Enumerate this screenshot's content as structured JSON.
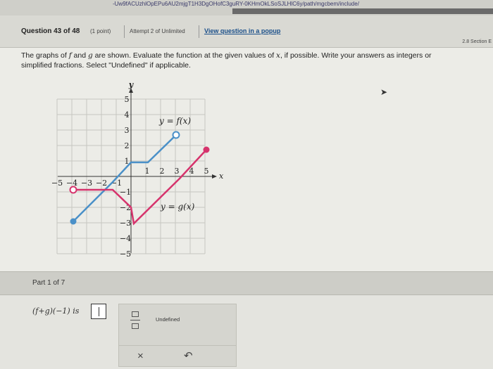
{
  "browser": {
    "url_fragment": "-Uw9fACUzhlOpEPu6AU2mjgT1H3DgOHofC3guRY-0KHmOkLSoSJLHlC6y/path/mgcbem/include/"
  },
  "header": {
    "question_number": "Question 43 of 48",
    "points": "(1 point)",
    "attempt": "Attempt 2 of Unlimited",
    "view_popup": "View question in a popup",
    "section": "2.8 Section E"
  },
  "question": {
    "text_a": "The graphs of ",
    "f": "f",
    "text_b": " and ",
    "g": "g",
    "text_c": " are shown. Evaluate the function at the given values of ",
    "x": "x",
    "text_d": ", if possible. Write your answers as integers or",
    "line2": "simplified fractions. Select \"Undefined\" if applicable."
  },
  "graph": {
    "x_axis_label": "x",
    "y_axis_label": "y",
    "x_ticks_neg": [
      "−5",
      "−4",
      "−3",
      "−2",
      "−1"
    ],
    "x_ticks_pos": [
      "1",
      "2",
      "3",
      "4",
      "5"
    ],
    "y_ticks_pos": [
      "5",
      "4",
      "3",
      "2",
      "1"
    ],
    "y_ticks_neg": [
      "−1",
      "−2",
      "−3",
      "−4",
      "−5"
    ],
    "f_label": "y = f(x)",
    "g_label": "y = g(x)",
    "f_color": "#4a90c8",
    "g_color": "#d6336c"
  },
  "part": {
    "label": "Part 1 of 7"
  },
  "answer": {
    "expression": "(f+g)(−1) is",
    "undefined_label": "Undefined",
    "clear_symbol": "×",
    "undo_symbol": "↶"
  }
}
